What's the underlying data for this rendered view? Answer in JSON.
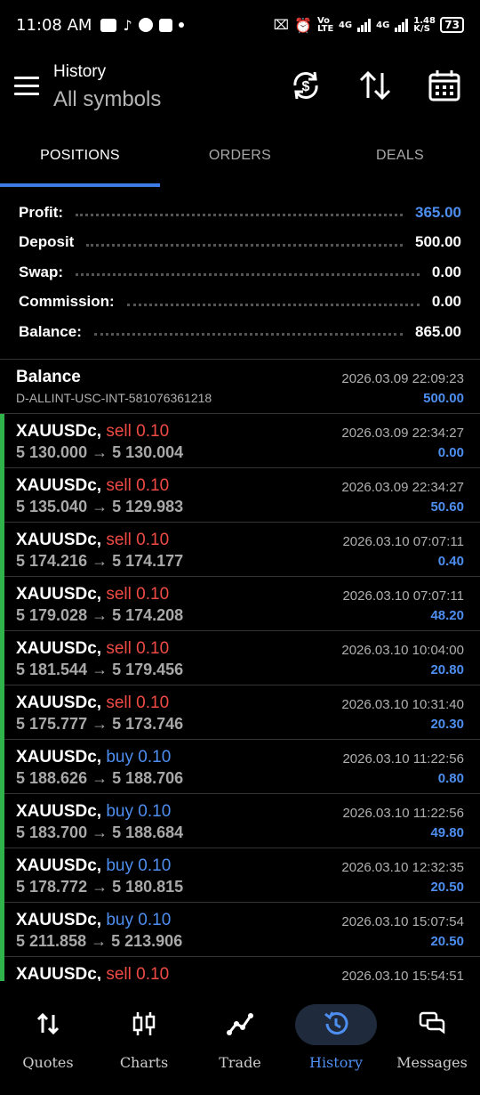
{
  "status_bar": {
    "time": "11:08 AM",
    "network_left": "Vo LTE",
    "network_4g_1": "4G",
    "network_4g_2": "4G",
    "speed": "1.48 K/S",
    "battery": "73"
  },
  "header": {
    "title": "History",
    "subtitle": "All symbols"
  },
  "tabs": [
    {
      "label": "POSITIONS",
      "active": true
    },
    {
      "label": "ORDERS",
      "active": false
    },
    {
      "label": "DEALS",
      "active": false
    }
  ],
  "summary": [
    {
      "label": "Profit:",
      "value": "365.00",
      "highlight": true
    },
    {
      "label": "Deposit",
      "value": "500.00",
      "highlight": false
    },
    {
      "label": "Swap:",
      "value": "0.00",
      "highlight": false
    },
    {
      "label": "Commission:",
      "value": "0.00",
      "highlight": false
    },
    {
      "label": "Balance:",
      "value": "865.00",
      "highlight": false
    }
  ],
  "balance_entry": {
    "title": "Balance",
    "account": "D-ALLINT-USC-INT-581076361218",
    "date": "2026.03.09 22:09:23",
    "amount": "500.00"
  },
  "deals": [
    {
      "symbol": "XAUUSDc,",
      "side": "sell",
      "lot": "0.10",
      "open": "5 130.000",
      "arrow": "→",
      "close": "5 130.004",
      "date": "2026.03.09 22:34:27",
      "profit": "0.00"
    },
    {
      "symbol": "XAUUSDc,",
      "side": "sell",
      "lot": "0.10",
      "open": "5 135.040",
      "arrow": "→",
      "close": "5 129.983",
      "date": "2026.03.09 22:34:27",
      "profit": "50.60"
    },
    {
      "symbol": "XAUUSDc,",
      "side": "sell",
      "lot": "0.10",
      "open": "5 174.216",
      "arrow": "→",
      "close": "5 174.177",
      "date": "2026.03.10 07:07:11",
      "profit": "0.40"
    },
    {
      "symbol": "XAUUSDc,",
      "side": "sell",
      "lot": "0.10",
      "open": "5 179.028",
      "arrow": "→",
      "close": "5 174.208",
      "date": "2026.03.10 07:07:11",
      "profit": "48.20"
    },
    {
      "symbol": "XAUUSDc,",
      "side": "sell",
      "lot": "0.10",
      "open": "5 181.544",
      "arrow": "→",
      "close": "5 179.456",
      "date": "2026.03.10 10:04:00",
      "profit": "20.80"
    },
    {
      "symbol": "XAUUSDc,",
      "side": "sell",
      "lot": "0.10",
      "open": "5 175.777",
      "arrow": "→",
      "close": "5 173.746",
      "date": "2026.03.10 10:31:40",
      "profit": "20.30"
    },
    {
      "symbol": "XAUUSDc,",
      "side": "buy",
      "lot": "0.10",
      "open": "5 188.626",
      "arrow": "→",
      "close": "5 188.706",
      "date": "2026.03.10 11:22:56",
      "profit": "0.80"
    },
    {
      "symbol": "XAUUSDc,",
      "side": "buy",
      "lot": "0.10",
      "open": "5 183.700",
      "arrow": "→",
      "close": "5 188.684",
      "date": "2026.03.10 11:22:56",
      "profit": "49.80"
    },
    {
      "symbol": "XAUUSDc,",
      "side": "buy",
      "lot": "0.10",
      "open": "5 178.772",
      "arrow": "→",
      "close": "5 180.815",
      "date": "2026.03.10 12:32:35",
      "profit": "20.50"
    },
    {
      "symbol": "XAUUSDc,",
      "side": "buy",
      "lot": "0.10",
      "open": "5 211.858",
      "arrow": "→",
      "close": "5 213.906",
      "date": "2026.03.10 15:07:54",
      "profit": "20.50"
    },
    {
      "symbol": "XAUUSDc,",
      "side": "sell",
      "lot": "0.10",
      "open": "",
      "arrow": "",
      "close": "",
      "date": "2026.03.10 15:54:51",
      "profit": ""
    }
  ],
  "bottom_nav": [
    {
      "label": "Quotes",
      "icon": "quotes-icon",
      "active": false
    },
    {
      "label": "Charts",
      "icon": "charts-icon",
      "active": false
    },
    {
      "label": "Trade",
      "icon": "trade-icon",
      "active": false
    },
    {
      "label": "History",
      "icon": "history-icon",
      "active": true
    },
    {
      "label": "Messages",
      "icon": "messages-icon",
      "active": false
    }
  ],
  "colors": {
    "accent": "#4d8ef0",
    "sell": "#ef4b44",
    "buy": "#4d8ef0",
    "position_bar": "#2fb34a"
  }
}
